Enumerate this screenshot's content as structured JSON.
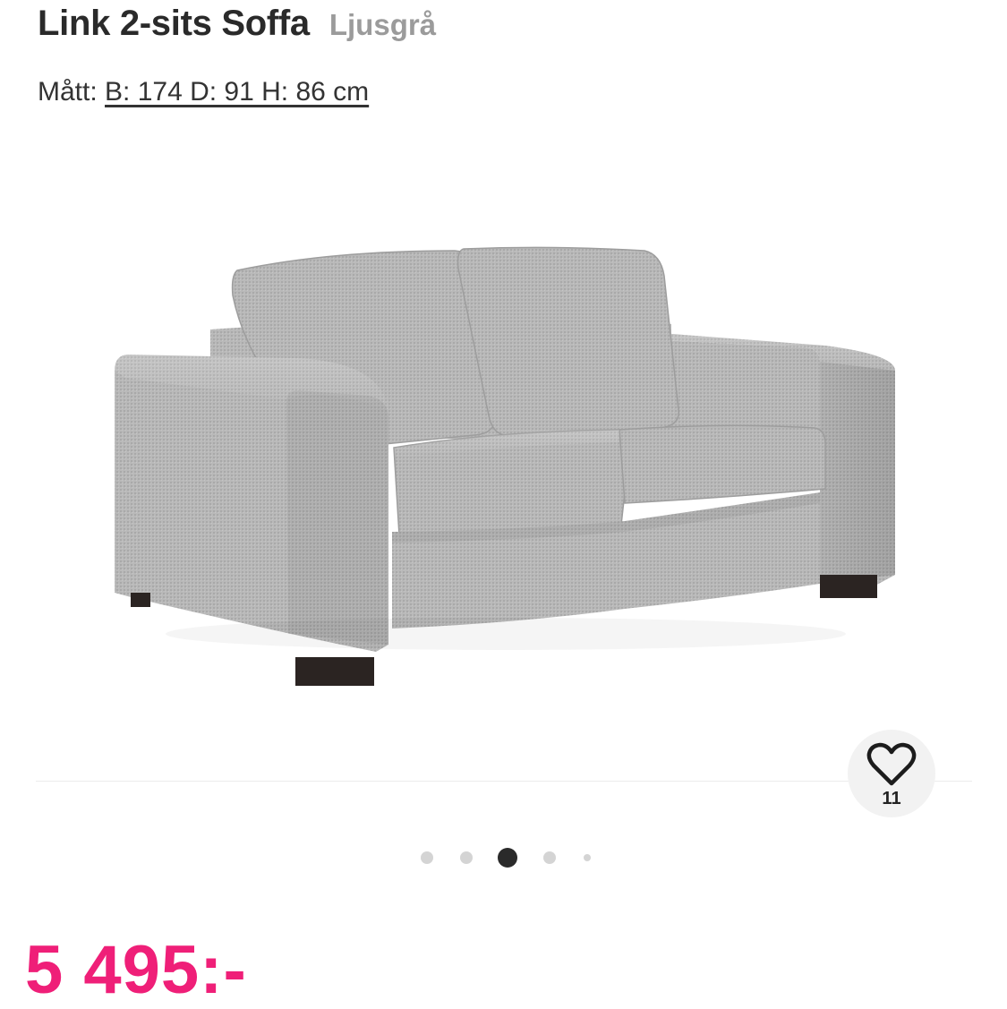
{
  "product": {
    "title": "Link 2-sits Soffa",
    "color_variant": "Ljusgrå",
    "dimensions_label": "Mått:",
    "dimensions_value": "B: 174 D: 91 H: 86 cm",
    "price": "5 495:-"
  },
  "favorites": {
    "icon": "heart-icon",
    "count": "11"
  },
  "carousel": {
    "total": 5,
    "active_index": 2
  },
  "colors": {
    "price": "#ef1f78",
    "title": "#2a2a2a",
    "variant": "#9b9b9b",
    "active_dot": "#2a2a2a",
    "inactive_dot": "#d4d4d4",
    "fabric": "#b7b7b7"
  }
}
